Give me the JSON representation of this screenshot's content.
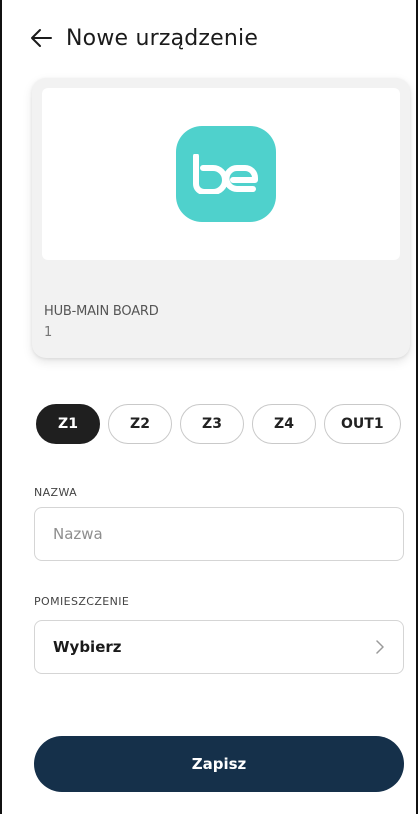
{
  "header": {
    "title": "Nowe urządzenie"
  },
  "device_card": {
    "name": "HUB-MAIN BOARD",
    "sub": "1",
    "logo_text": "be",
    "logo_color": "#4fd1cc"
  },
  "zones": [
    {
      "label": "Z1",
      "active": true
    },
    {
      "label": "Z2",
      "active": false
    },
    {
      "label": "Z3",
      "active": false
    },
    {
      "label": "Z4",
      "active": false
    },
    {
      "label": "OUT1",
      "active": false
    }
  ],
  "form": {
    "name_label": "NAZWA",
    "name_placeholder": "Nazwa",
    "name_value": "",
    "room_label": "POMIESZCZENIE",
    "room_value": "Wybierz"
  },
  "actions": {
    "save_label": "Zapisz"
  },
  "colors": {
    "primary": "#15304a",
    "chip_active": "#1f1f1f"
  }
}
